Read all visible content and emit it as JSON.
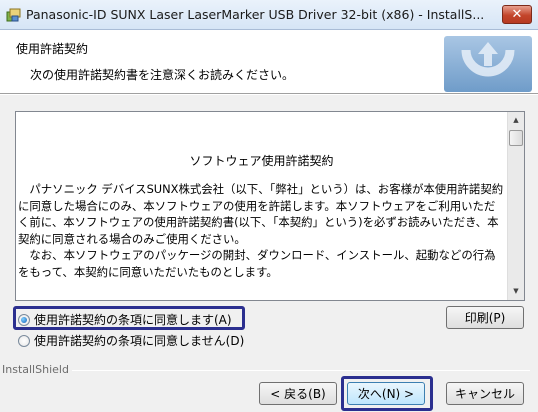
{
  "window": {
    "title": "Panasonic-ID SUNX Laser LaserMarker USB Driver 32-bit (x86) - InstallS...",
    "close_label": "✕"
  },
  "header": {
    "title": "使用許諾契約",
    "subtitle": "次の使用許諾契約書を注意深くお読みください。"
  },
  "license": {
    "heading": "ソフトウェア使用許諾契約",
    "paragraphs": [
      "パナソニック デバイスSUNX株式会社（以下、「弊社」という）は、お客様が本使用許諾契約に同意した場合にのみ、本ソフトウェアの使用を許諾します。本ソフトウェアをご利用いただく前に、本ソフトウェアの使用許諾契約書(以下、「本契約」という)を必ずお読みいただき、本契約に同意される場合のみご使用ください。",
      "なお、本ソフトウェアのパッケージの開封、ダウンロード、インストール、起動などの行為をもって、本契約に同意いただいたものとします。"
    ]
  },
  "options": {
    "agree_label": "使用許諾契約の条項に同意します(A)",
    "disagree_label": "使用許諾契約の条項に同意しません(D)",
    "selected": "agree"
  },
  "buttons": {
    "print": "印刷(P)",
    "back": "< 戻る(B)",
    "next": "次へ(N) >",
    "cancel": "キャンセル"
  },
  "footer": {
    "brand": "InstallShield"
  },
  "colors": {
    "highlight": "#2b2f8f",
    "titlebar": "#dce8f6"
  }
}
